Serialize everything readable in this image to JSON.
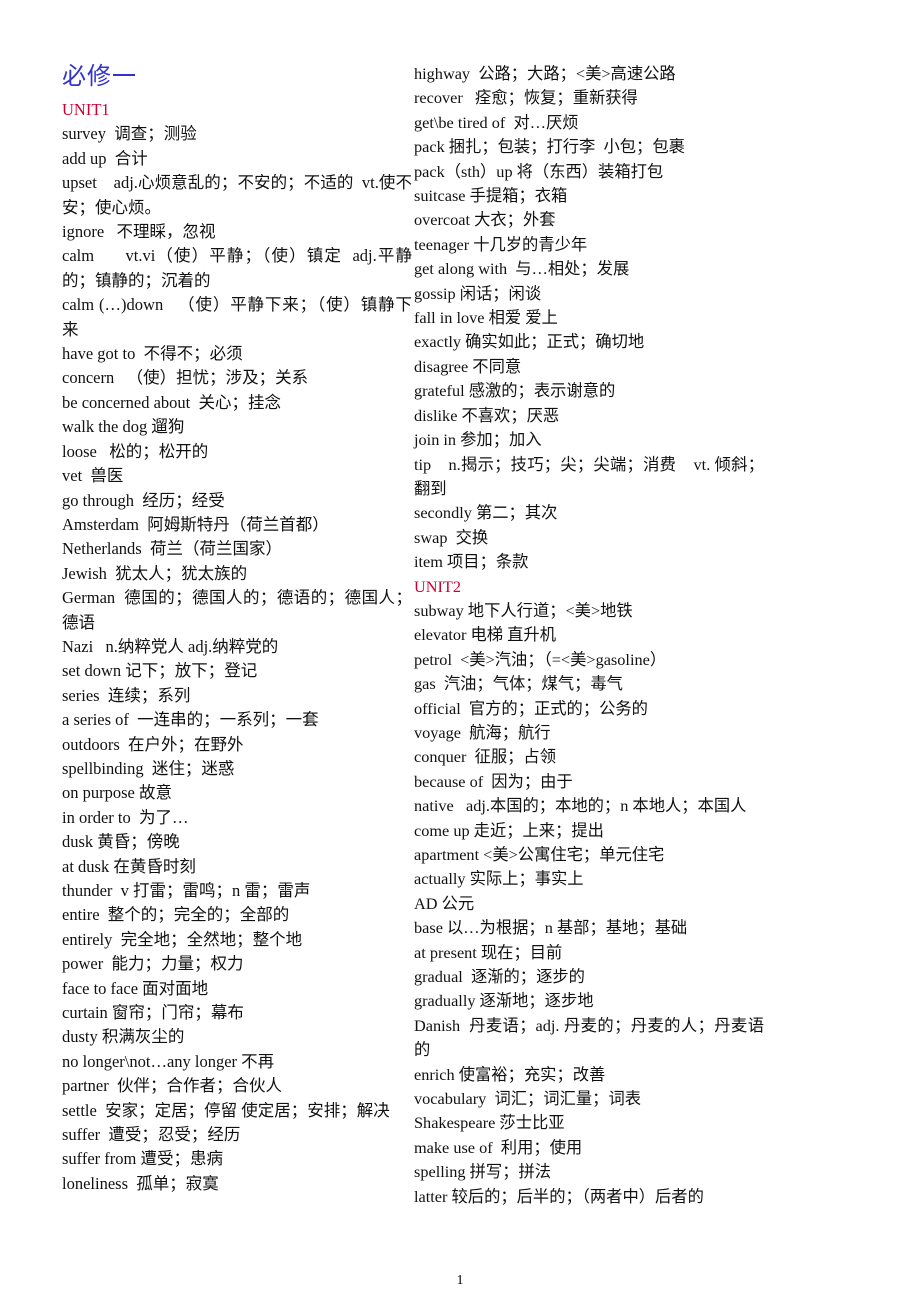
{
  "document": {
    "title": "必修一",
    "title_color": "#3333cc",
    "unit_heading_color": "#cc0033",
    "page_number": "1"
  },
  "columns": {
    "left": {
      "unit_heading": "UNIT1",
      "entries": [
        "survey  调查；测验",
        "add up  合计",
        "upset    adj.心烦意乱的；不安的；不适的  vt.使不安；使心烦。",
        "ignore   不理睬，忽视",
        "calm      vt.vi（使）平静；（使）镇定  adj.平静的；镇静的；沉着的",
        "calm (…)down   （使）平静下来；（使）镇静下来",
        "have got to  不得不；必须",
        "concern   （使）担忧；涉及；关系",
        "be concerned about  关心；挂念",
        "walk the dog 遛狗",
        "loose   松的；松开的",
        "vet  兽医",
        "go through  经历；经受",
        "Amsterdam  阿姆斯特丹（荷兰首都）",
        "Netherlands  荷兰（荷兰国家）",
        "Jewish  犹太人；犹太族的",
        "German  德国的；德国人的；德语的；德国人；德语",
        "Nazi   n.纳粹党人 adj.纳粹党的",
        "set down 记下；放下；登记",
        "series  连续；系列",
        "a series of  一连串的；一系列；一套",
        "outdoors  在户外；在野外",
        "spellbinding  迷住；迷惑",
        "on purpose 故意",
        "in order to  为了…",
        "dusk 黄昏；傍晚",
        "at dusk 在黄昏时刻",
        "thunder  v 打雷；雷鸣；n 雷；雷声",
        "entire  整个的；完全的；全部的",
        "entirely  完全地；全然地；整个地",
        "power  能力；力量；权力",
        "face to face 面对面地",
        "curtain 窗帘；门帘；幕布",
        "dusty 积满灰尘的",
        "no longer\\not…any longer 不再",
        "partner  伙伴；合作者；合伙人",
        "settle  安家；定居；停留 使定居；安排；解决",
        "suffer  遭受；忍受；经历",
        "suffer from 遭受；患病",
        "loneliness  孤单；寂寞"
      ]
    },
    "right": {
      "entries_before_unit": [
        "highway  公路；大路；<美>高速公路",
        "recover   痊愈；恢复；重新获得",
        "get\\be tired of  对…厌烦",
        "pack 捆扎；包装；打行李  小包；包裹",
        "pack（sth）up 将（东西）装箱打包",
        "suitcase 手提箱；衣箱",
        "overcoat 大衣；外套",
        "teenager 十几岁的青少年",
        "get along with  与…相处；发展",
        "gossip 闲话；闲谈",
        "fall in love 相爱 爱上",
        "exactly 确实如此；正式；确切地",
        "disagree 不同意",
        "grateful 感激的；表示谢意的",
        "dislike 不喜欢；厌恶",
        "join in 参加；加入",
        "tip    n.揭示；技巧；尖；尖端；消费    vt. 倾斜；  翻到",
        "secondly 第二；其次",
        "swap  交换",
        "item 项目；条款"
      ],
      "unit_heading": "UNIT2",
      "entries_after_unit": [
        "subway 地下人行道；<美>地铁",
        "elevator 电梯 直升机",
        "petrol  <美>汽油；（=<美>gasoline）",
        "gas  汽油；气体；煤气；毒气",
        "official  官方的；正式的；公务的",
        "voyage  航海；航行",
        "conquer  征服；占领",
        "because of  因为；由于",
        "native   adj.本国的；本地的；n 本地人；本国人",
        "come up 走近；上来；提出",
        "apartment <美>公寓住宅；单元住宅",
        "actually 实际上；事实上",
        "AD 公元",
        "base 以…为根据；n 基部；基地；基础",
        "at present 现在；目前",
        "gradual  逐渐的；逐步的",
        "gradually 逐渐地；逐步地",
        "Danish  丹麦语；adj. 丹麦的；丹麦的人；丹麦语的",
        "enrich 使富裕；充实；改善",
        "vocabulary  词汇；词汇量；词表",
        "Shakespeare 莎士比亚",
        "make use of  利用；使用",
        "spelling 拼写；拼法",
        "latter 较后的；后半的；（两者中）后者的"
      ]
    }
  }
}
